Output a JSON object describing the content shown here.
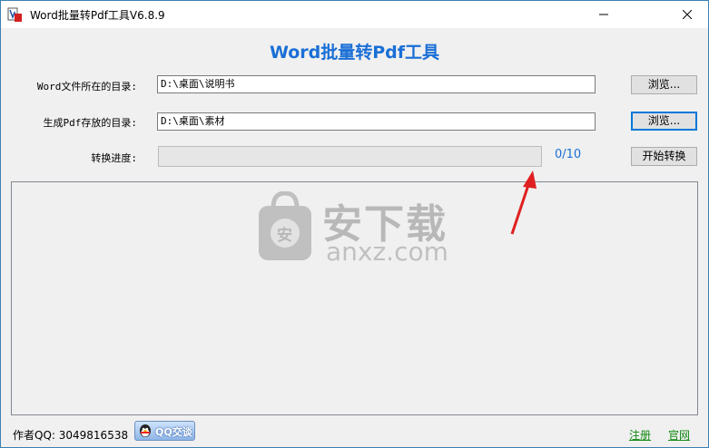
{
  "window": {
    "title": "Word批量转Pdf工具V6.8.9"
  },
  "heading": "Word批量转Pdf工具",
  "form": {
    "source_label": "Word文件所在的目录:",
    "source_value": "D:\\桌面\\说明书",
    "output_label": "生成Pdf存放的目录:",
    "output_value": "D:\\桌面\\素材",
    "progress_label": "转换进度:",
    "progress_text": "0/10",
    "progress_fraction": 0,
    "browse_label": "浏览...",
    "browse2_label": "浏览...",
    "start_label": "开始转换"
  },
  "watermark": {
    "main": "安下载",
    "sub": "anxz.com",
    "badge": "安"
  },
  "footer": {
    "author": "作者QQ: 3049816538",
    "qq_button": "QQ交谈",
    "register": "注册",
    "website": "官网"
  },
  "colors": {
    "accent": "#1a6fd6",
    "link": "#118811",
    "arrow": "#e02020"
  },
  "icons": [
    "app-icon",
    "minimize-icon",
    "close-icon",
    "qq-icon",
    "bag-icon",
    "arrow-annotation"
  ]
}
